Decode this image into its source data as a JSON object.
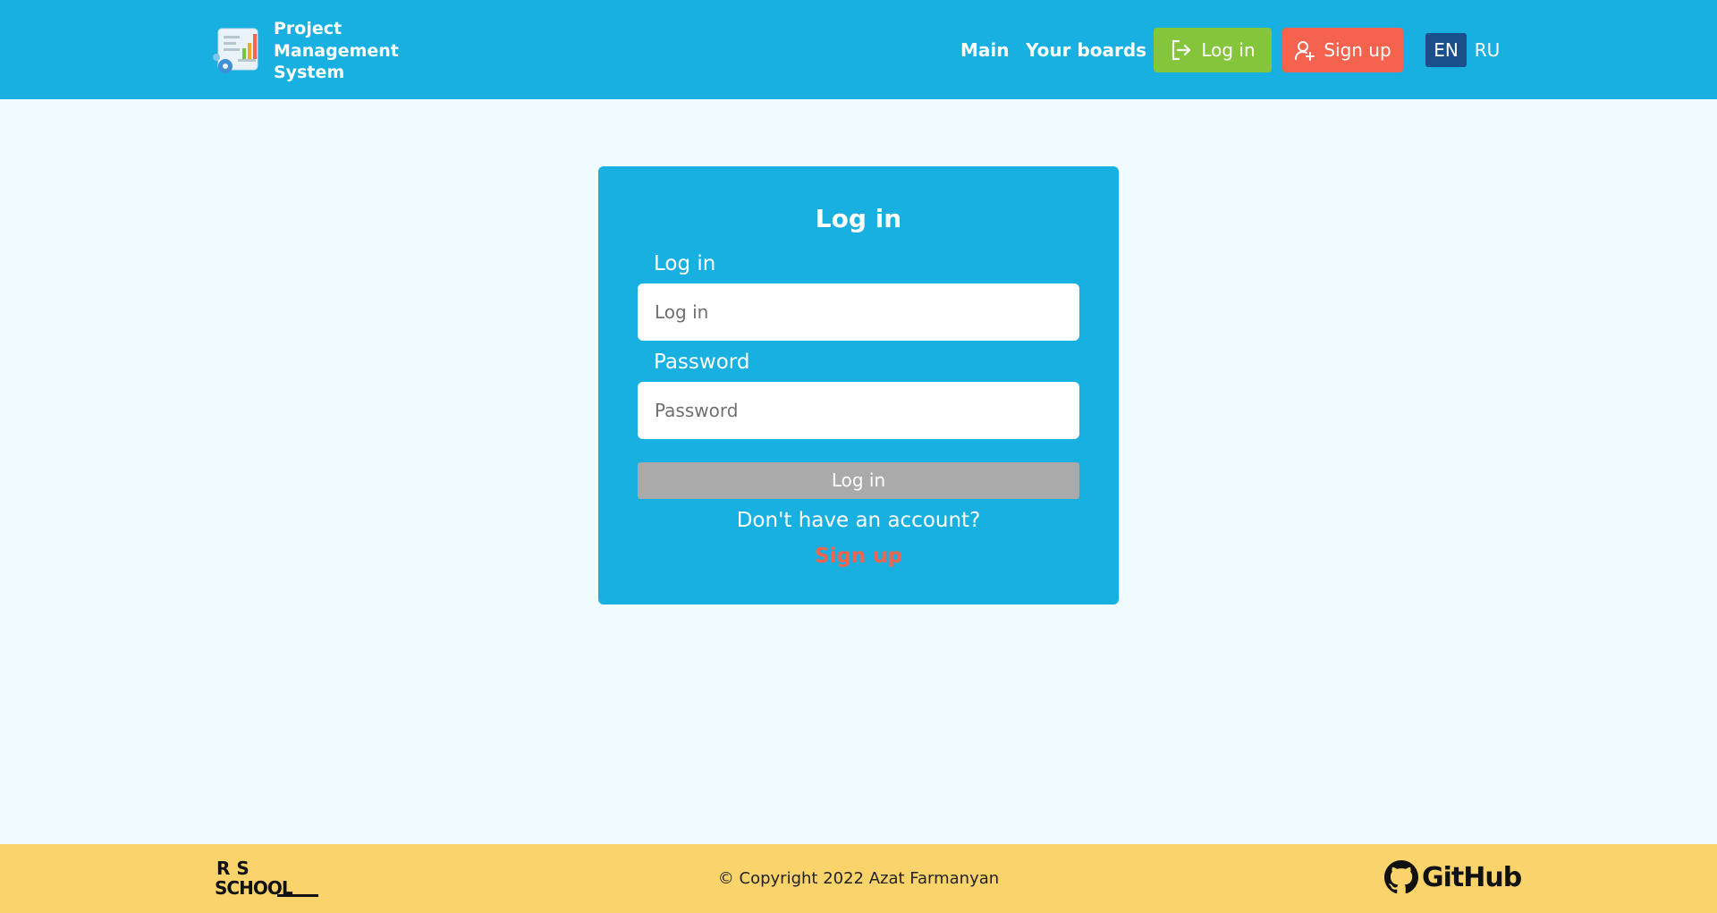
{
  "header": {
    "brand_line1": "Project",
    "brand_line2": "Management",
    "brand_line3": "System",
    "nav_main": "Main",
    "nav_boards": "Your boards",
    "login_button": "Log in",
    "signup_button": "Sign up",
    "lang_en": "EN",
    "lang_ru": "RU"
  },
  "form": {
    "title": "Log in",
    "login_label": "Log in",
    "login_placeholder": "Log in",
    "login_value": "",
    "password_label": "Password",
    "password_placeholder": "Password",
    "password_value": "",
    "submit_label": "Log in",
    "no_account_text": "Don't have an account?",
    "signup_link": "Sign up"
  },
  "footer": {
    "rs_logo_top": "R S",
    "rs_logo_bottom": "SCHOOL",
    "copyright": "© Copyright 2022 Azat Farmanyan",
    "github_label": "GitHub"
  },
  "colors": {
    "primary": "#18b0e0",
    "login_green": "#84c53c",
    "signup_red": "#f5624e",
    "lang_active": "#1b4f8a",
    "footer_bg": "#fad46b",
    "submit_disabled": "#aaaaaa"
  },
  "icons": [
    "app-logo-icon",
    "login-icon",
    "add-user-icon",
    "rs-school-logo",
    "github-icon"
  ]
}
